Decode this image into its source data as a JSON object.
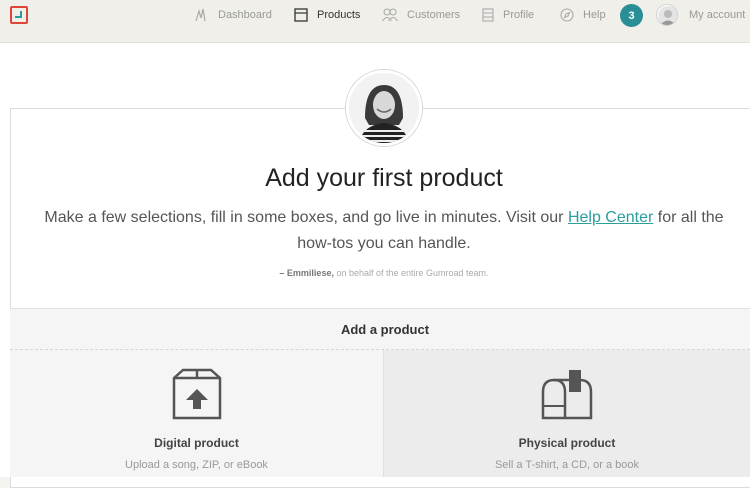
{
  "nav": {
    "items": [
      {
        "label": "Dashboard",
        "icon": "chart-icon",
        "active": false
      },
      {
        "label": "Products",
        "icon": "box-icon",
        "active": true
      },
      {
        "label": "Customers",
        "icon": "people-icon",
        "active": false
      },
      {
        "label": "Profile",
        "icon": "profile-icon",
        "active": false
      },
      {
        "label": "Help",
        "icon": "compass-icon",
        "active": false
      }
    ],
    "notification_count": "3",
    "account_label": "My account"
  },
  "hero": {
    "title": "Add your first product",
    "subtitle_before": "Make a few selections, fill in some boxes, and go live in minutes. Visit our ",
    "link_text": "Help Center",
    "subtitle_after": " for all the how-tos you can handle.",
    "signature_name": "– Emmiliese,",
    "signature_rest": " on behalf of the entire Gumroad team."
  },
  "add_product": {
    "header": "Add a product",
    "options": [
      {
        "title": "Digital product",
        "description": "Upload a song, ZIP, or eBook",
        "icon": "upload-box-icon"
      },
      {
        "title": "Physical product",
        "description": "Sell a T-shirt, a CD, or a book",
        "icon": "mailbox-icon"
      }
    ]
  },
  "colors": {
    "accent": "#2a9d9d",
    "badge": "#2a8e96",
    "logo_red": "#e0453a"
  }
}
